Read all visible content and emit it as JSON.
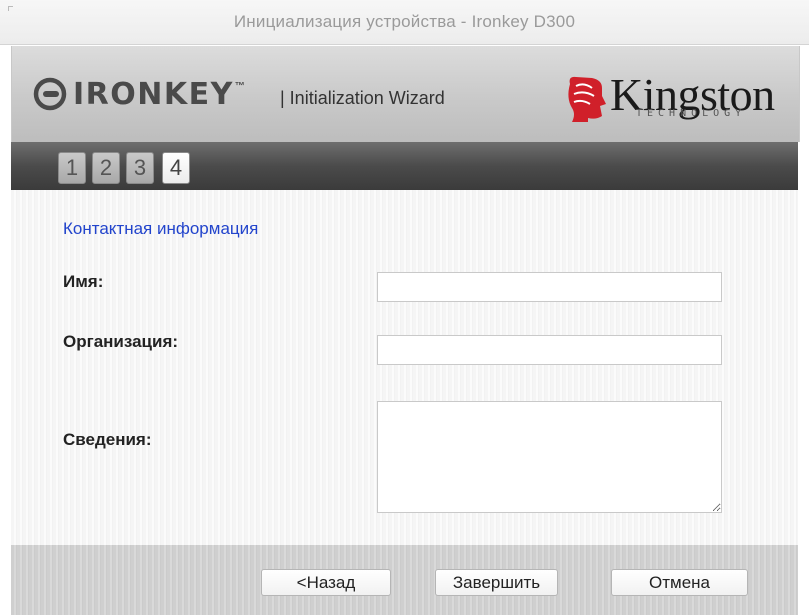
{
  "window": {
    "title": "Инициализация устройства - Ironkey D300"
  },
  "header": {
    "brand_name": "IRONKEY",
    "brand_tm": "™",
    "wizard_label": "| Initialization Wizard",
    "partner_name": "Kingston",
    "partner_subtext": "TECHNOLOGY"
  },
  "steps": [
    {
      "label": "1",
      "active": false
    },
    {
      "label": "2",
      "active": false
    },
    {
      "label": "3",
      "active": false
    },
    {
      "label": "4",
      "active": true
    }
  ],
  "form": {
    "section_title": "Контактная информация",
    "name_label": "Имя:",
    "name_value": "",
    "organization_label": "Организация:",
    "organization_value": "",
    "details_label": "Сведения:",
    "details_value": ""
  },
  "buttons": {
    "back": "<Назад",
    "finish": "Завершить",
    "cancel": "Отмена"
  },
  "colors": {
    "section_title": "#2244cc",
    "kingston_red": "#d0202a"
  }
}
